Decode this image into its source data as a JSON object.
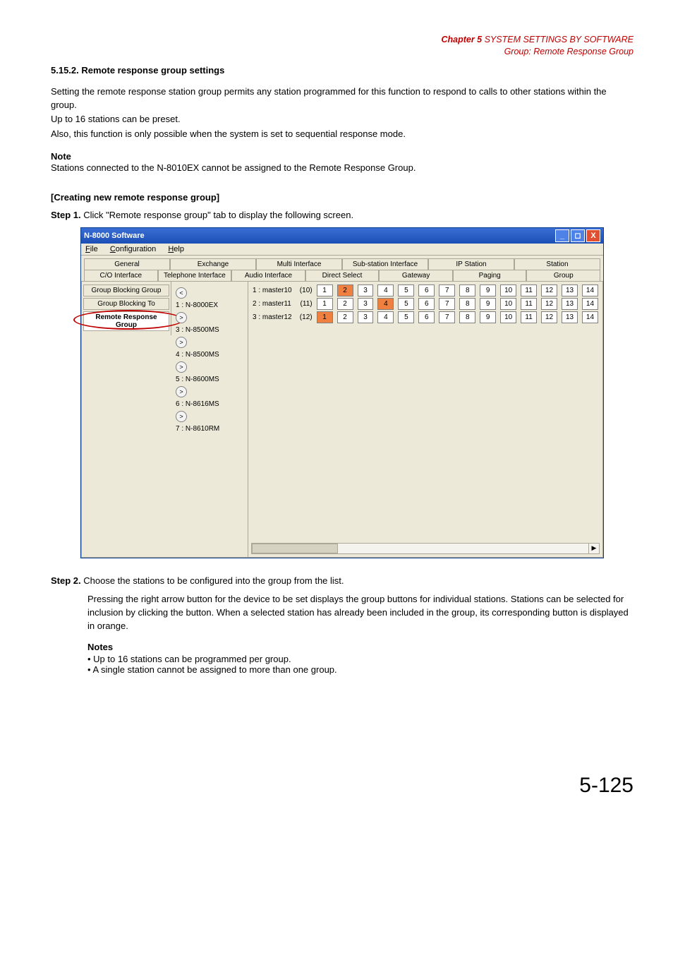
{
  "chapter": {
    "line1_prefix": "Chapter 5",
    "line1_rest": "   SYSTEM SETTINGS BY SOFTWARE",
    "line2": "Group: Remote Response Group"
  },
  "section_title": "5.15.2. Remote response group settings",
  "intro": {
    "p1": "Setting the remote response station group permits any station programmed for this function to respond to calls to other stations within the group.",
    "p2": "Up to 16 stations can be preset.",
    "p3": "Also, this function is only possible when the system is set to sequential response mode."
  },
  "note": {
    "heading": "Note",
    "body": "Stations connected to the N-8010EX cannot be assigned to the Remote Response Group."
  },
  "create_heading": "[Creating new remote response group]",
  "step1": {
    "label": "Step 1.",
    "text": "Click \"Remote response group\" tab to display the following screen."
  },
  "window": {
    "title": "N-8000 Software",
    "menus": {
      "file": "File",
      "config": "Configuration",
      "help": "Help"
    },
    "top_tabs_row1": [
      "General",
      "Exchange",
      "Multi Interface",
      "Sub-station Interface",
      "IP Station",
      "Station"
    ],
    "top_tabs_row2": [
      "C/O Interface",
      "Telephone Interface",
      "Audio Interface",
      "Direct Select",
      "Gateway",
      "Paging",
      "Group"
    ],
    "left_tabs": [
      "Group Blocking Group",
      "Group Blocking To",
      "Remote Response Group"
    ],
    "tree": [
      {
        "btn": "<",
        "label": ""
      },
      {
        "btn": "",
        "label": "1 : N-8000EX",
        "no_btn": true,
        "offset": true
      },
      {
        "btn": ">",
        "label": ""
      },
      {
        "btn": "",
        "label": "3 : N-8500MS",
        "no_btn": true
      },
      {
        "btn": ">",
        "label": ""
      },
      {
        "btn": "",
        "label": "4 : N-8500MS",
        "no_btn": true
      },
      {
        "btn": ">",
        "label": ""
      },
      {
        "btn": "",
        "label": "5 : N-8600MS",
        "no_btn": true
      },
      {
        "btn": ">",
        "label": ""
      },
      {
        "btn": "",
        "label": "6 : N-8616MS",
        "no_btn": true
      },
      {
        "btn": ">",
        "label": ""
      },
      {
        "btn": "",
        "label": "7 : N-8610RM",
        "no_btn": true
      }
    ],
    "masters": [
      {
        "label": "1 : master10",
        "idx": "(10)",
        "cells": [
          1,
          2,
          3,
          4,
          5,
          6,
          7,
          8,
          9,
          10,
          11,
          12,
          13,
          14
        ],
        "selected": [
          2
        ]
      },
      {
        "label": "2 : master11",
        "idx": "(11)",
        "cells": [
          1,
          2,
          3,
          4,
          5,
          6,
          7,
          8,
          9,
          10,
          11,
          12,
          13,
          14
        ],
        "selected": [
          4
        ]
      },
      {
        "label": "3 : master12",
        "idx": "(12)",
        "cells": [
          1,
          2,
          3,
          4,
          5,
          6,
          7,
          8,
          9,
          10,
          11,
          12,
          13,
          14
        ],
        "selected": [
          1
        ]
      }
    ]
  },
  "step2": {
    "label": "Step 2.",
    "lead": "Choose the stations to be configured into the group from the list.",
    "body": "Pressing the right arrow button for the device to be set displays the group buttons for individual stations. Stations can be selected for inclusion by clicking the button. When a selected station has already been included in  the group, its corresponding button is displayed in orange.",
    "notes_heading": "Notes",
    "notes": [
      "Up to 16 stations can be programmed per group.",
      "A single station cannot be assigned to more than one group."
    ]
  },
  "pagenum": "5-125"
}
